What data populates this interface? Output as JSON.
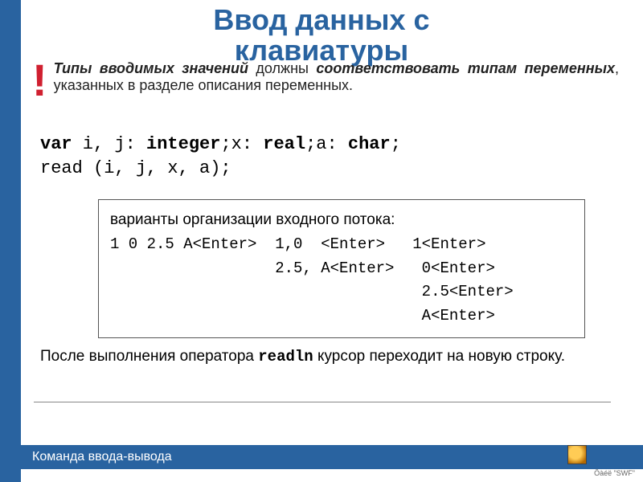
{
  "title_line1": "Ввод данных с",
  "title_line2": "клавиатуры",
  "warn_bang": "!",
  "warn_html_parts": {
    "p1": "Типы вводимых значений",
    "p2": " должны ",
    "p3": "соответствовать типам переменных",
    "p4": ", указанных в разделе описания переменных."
  },
  "code": {
    "l1_a": "var",
    "l1_b": " i, j: ",
    "l1_c": "integer",
    "l1_d": ";x: ",
    "l1_e": "real",
    "l1_f": ";a: ",
    "l1_g": "char",
    "l1_h": ";",
    "l2": "read (i, j, x, a);"
  },
  "box": {
    "header": "варианты организации входного потока:",
    "r1": "1 0 2.5 А<Enter>  1,0  <Enter>   1<Enter>",
    "r2": "                  2.5, А<Enter>   0<Enter>",
    "r3": "                                  2.5<Enter>",
    "r4": "                                  А<Enter>"
  },
  "after": {
    "a": "После выполнения оператора ",
    "b": "readln",
    "c": " курсор переходит на новую строку."
  },
  "footer": "Команда ввода-вывода",
  "ft_small": "Ôàéë \"SWF\""
}
